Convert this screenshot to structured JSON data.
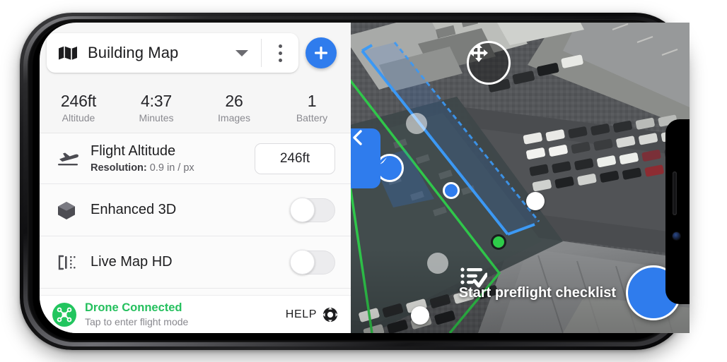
{
  "app": {
    "title": "Building Map",
    "map_icon": "map-icon",
    "dropdown_icon": "chevron-down-icon",
    "overflow_icon": "kebab-menu-icon",
    "add_icon": "plus-icon"
  },
  "stats": [
    {
      "value": "246ft",
      "label": "Altitude",
      "name": "altitude"
    },
    {
      "value": "4:37",
      "label": "Minutes",
      "name": "minutes"
    },
    {
      "value": "26",
      "label": "Images",
      "name": "images"
    },
    {
      "value": "1",
      "label": "Battery",
      "name": "battery"
    }
  ],
  "settings": {
    "flight_altitude": {
      "icon": "airplane-takeoff-icon",
      "title": "Flight Altitude",
      "resolution_label": "Resolution:",
      "resolution_value": "0.9 in / px",
      "chip_value": "246ft"
    },
    "enhanced_3d": {
      "icon": "cube-icon",
      "title": "Enhanced 3D",
      "toggle_state": "off"
    },
    "live_map_hd": {
      "icon": "live-map-icon",
      "title": "Live Map HD",
      "toggle_state": "off"
    }
  },
  "status_bar": {
    "badge_icon": "drone-icon",
    "title": "Drone Connected",
    "subtitle": "Tap to enter flight mode",
    "help_label": "HELP",
    "help_icon": "life-ring-icon"
  },
  "map": {
    "collapse_icon": "chevron-left-icon",
    "move_handle_icon": "move-arrows-icon",
    "location_icon": "navigation-arrow-icon",
    "preflight_label": "Start preflight checklist",
    "preflight_icon": "checklist-check-icon"
  },
  "colors": {
    "accent_blue": "#2f7ced",
    "connected_green": "#25c05e",
    "boundary_green": "#2ecc4a",
    "flight_path_blue": "#3d9bf5",
    "panel_bg": "#f6f6f6"
  }
}
